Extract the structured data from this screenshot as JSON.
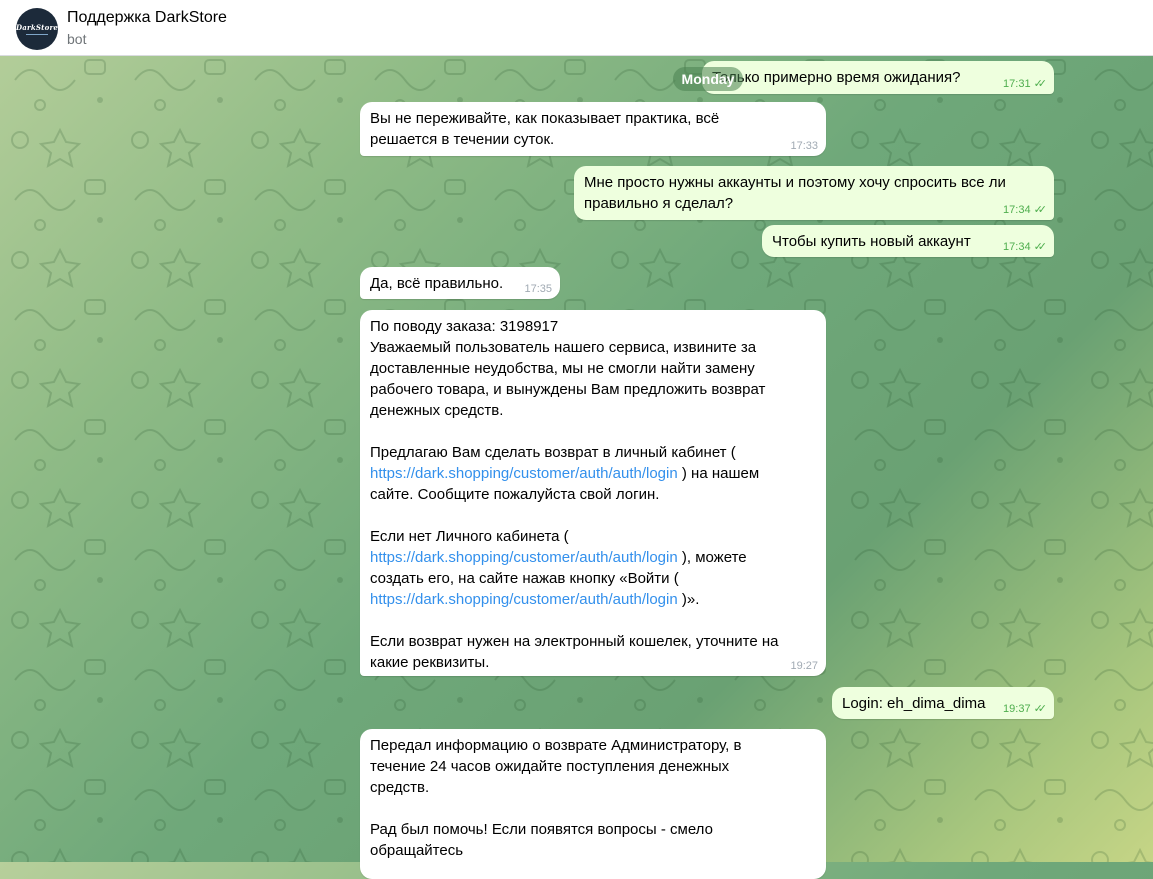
{
  "header": {
    "chat_title": "Поддержка DarkStore",
    "chat_subtitle": "bot",
    "avatar_logo": "DarkStore"
  },
  "date_chip": "Monday",
  "messages": [
    {
      "text": "Только примерно время ожидания?",
      "time": "17:31",
      "direction": "out"
    },
    {
      "text": "Вы не переживайте, как показывает практика, всё\nрешается в течении суток.",
      "time": "17:33",
      "direction": "in"
    },
    {
      "text": "Мне просто нужны аккаунты и поэтому хочу спросить все ли\nправильно я сделал?",
      "time": "17:34",
      "direction": "out"
    },
    {
      "text": "Чтобы купить новый аккаунт",
      "time": "17:34",
      "direction": "out"
    },
    {
      "text": "Да, всё правильно.",
      "time": "17:35",
      "direction": "in"
    },
    {
      "direction": "in",
      "time": "19:27",
      "p1": "По поводу заказа: 3198917\nУважаемый пользователь нашего сервиса, извините за\nдоставленные неудобства, мы не смогли найти замену\nрабочего товара, и вынуждены Вам предложить возврат\nденежных средств.",
      "p2a": "Предлагаю Вам сделать возврат в личный кабинет (\n",
      "link1": "https://dark.shopping/customer/auth/auth/login",
      "p2b": " ) на нашем\nсайте. Сообщите пожалуйста свой логин.",
      "p3a": "Если нет Личного кабинета (\n",
      "link2": "https://dark.shopping/customer/auth/auth/login",
      "p3b": " ), можете\nсоздать его, на сайте нажав кнопку «Войти (\n",
      "link3": "https://dark.shopping/customer/auth/auth/login",
      "p3c": " )».",
      "p4": "Если возврат нужен на электронный кошелек, уточните на\nкакие реквизиты."
    },
    {
      "text": "Login: eh_dima_dima",
      "time": "19:37",
      "direction": "out"
    },
    {
      "text": "Передал информацию о возврате Администратору, в\nтечение 24 часов ожидайте поступления денежных\nсредств.\n\nРад был помочь! Если появятся вопросы - смело\nобращайтесь",
      "direction": "in"
    }
  ],
  "colors": {
    "incoming_bubble": "#ffffff",
    "outgoing_bubble": "#eeffde",
    "link": "#3390ec",
    "outgoing_meta": "#4fae4e"
  },
  "icons": [
    "double-check-icon"
  ]
}
